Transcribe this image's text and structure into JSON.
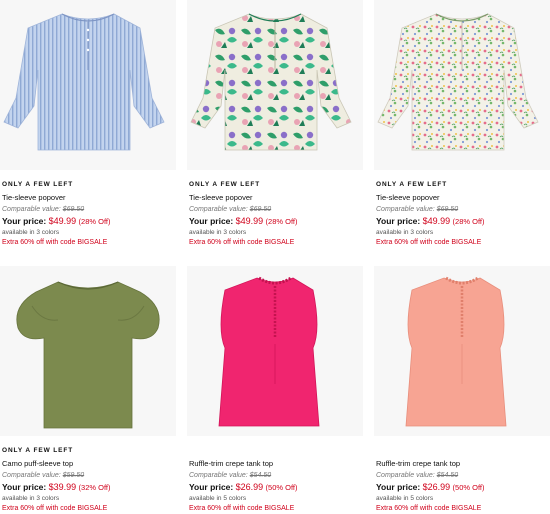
{
  "products": [
    {
      "badge": "ONLY A FEW LEFT",
      "name": "Tie-sleeve popover",
      "comparable_label": "Comparable value:",
      "comparable_value": "$69.50",
      "price_label": "Your price:",
      "price": "$49.99",
      "discount": "(28% Off)",
      "colors": "available in 3 colors",
      "promo": "Extra 60% off with code BIGSALE",
      "image_icon": "blue-stripe-blouse-image"
    },
    {
      "badge": "ONLY A FEW LEFT",
      "name": "Tie-sleeve popover",
      "comparable_label": "Comparable value:",
      "comparable_value": "$69.50",
      "price_label": "Your price:",
      "price": "$49.99",
      "discount": "(28% Off)",
      "colors": "available in 3 colors",
      "promo": "Extra 60% off with code BIGSALE",
      "image_icon": "floral-blouse-image"
    },
    {
      "badge": "ONLY A FEW LEFT",
      "name": "Tie-sleeve popover",
      "comparable_label": "Comparable value:",
      "comparable_value": "$69.50",
      "price_label": "Your price:",
      "price": "$49.99",
      "discount": "(28% Off)",
      "colors": "available in 3 colors",
      "promo": "Extra 60% off with code BIGSALE",
      "image_icon": "small-floral-blouse-image"
    },
    {
      "badge": "ONLY A FEW LEFT",
      "name": "Camo puff-sleeve top",
      "comparable_label": "Comparable value:",
      "comparable_value": "$59.50",
      "price_label": "Your price:",
      "price": "$39.99",
      "discount": "(32% Off)",
      "colors": "available in 3 colors",
      "promo": "Extra 60% off with code BIGSALE",
      "image_icon": "olive-puff-sleeve-top-image"
    },
    {
      "badge": "",
      "name": "Ruffle-trim crepe tank top",
      "comparable_label": "Comparable value:",
      "comparable_value": "$54.50",
      "price_label": "Your price:",
      "price": "$26.99",
      "discount": "(50% Off)",
      "colors": "available in 5 colors",
      "promo": "Extra 60% off with code BIGSALE",
      "image_icon": "pink-ruffle-tank-image"
    },
    {
      "badge": "",
      "name": "Ruffle-trim crepe tank top",
      "comparable_label": "Comparable value:",
      "comparable_value": "$54.50",
      "price_label": "Your price:",
      "price": "$26.99",
      "discount": "(50% Off)",
      "colors": "available in 5 colors",
      "promo": "Extra 60% off with code BIGSALE",
      "image_icon": "peach-ruffle-tank-image"
    }
  ],
  "colors": {
    "sale_red": "#d0021b",
    "blue_shirt": "#b9cdea",
    "olive_top": "#7c8a4e",
    "pink_tank": "#f0256f",
    "peach_tank": "#f7a493"
  }
}
